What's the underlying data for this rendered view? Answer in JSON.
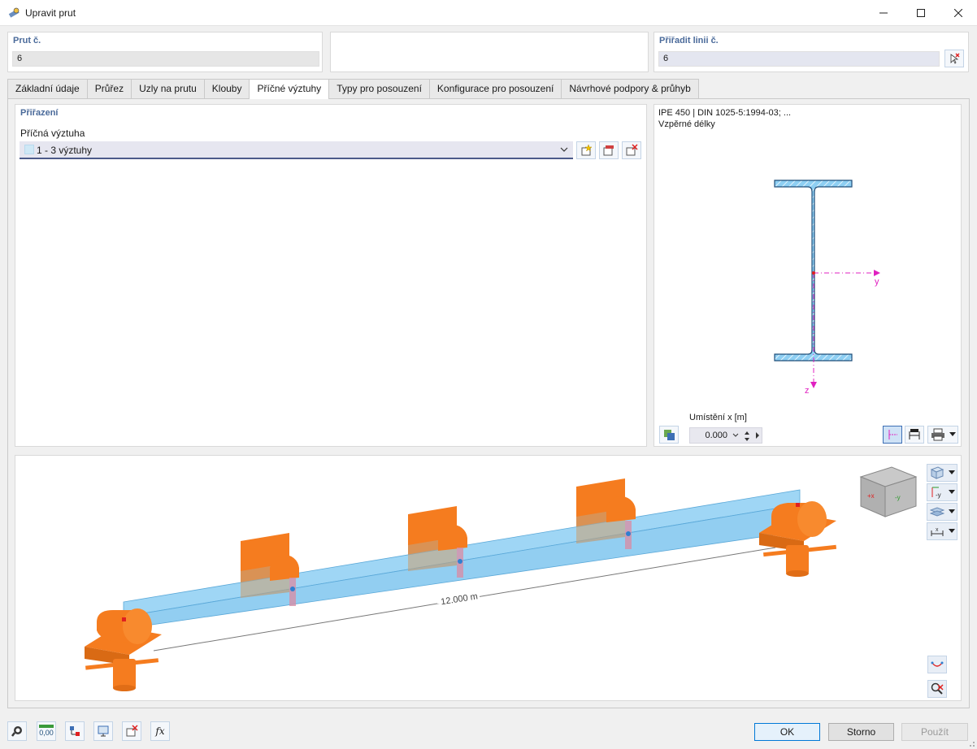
{
  "window": {
    "title": "Upravit prut"
  },
  "member": {
    "label": "Prut č.",
    "value": "6"
  },
  "line": {
    "label": "Přiřadit linii č.",
    "value": "6"
  },
  "tabs": [
    "Základní údaje",
    "Průřez",
    "Uzly na prutu",
    "Klouby",
    "Příčné výztuhy",
    "Typy pro posouzení",
    "Konfigurace pro posouzení",
    "Návrhové podpory & průhyb"
  ],
  "assignment": {
    "section_title": "Přiřazení",
    "field_label": "Příčná výztuha",
    "selected_value": "1 - 3 výztuhy"
  },
  "section_preview": {
    "line1": "IPE 450 | DIN 1025-5:1994-03; ...",
    "line2": "Vzpěrné délky",
    "axis_y": "y",
    "axis_z": "z",
    "position_label": "Umístění x [m]",
    "position_value": "0.000"
  },
  "model_view": {
    "dimension_label": "12.000 m",
    "cube_face_left": "+x",
    "cube_face_right": "-y",
    "axis_btn_label": "-y",
    "dim_btn_label": "x"
  },
  "bottom_toolbar": {
    "units_label": "0,00",
    "fx_label": "fx"
  },
  "buttons": {
    "ok": "OK",
    "cancel": "Storno",
    "apply": "Použít"
  },
  "colors": {
    "accent": "#0078d7",
    "beam": "#7fc6ef",
    "support": "#f57c1f",
    "axis": "#e020c0"
  }
}
